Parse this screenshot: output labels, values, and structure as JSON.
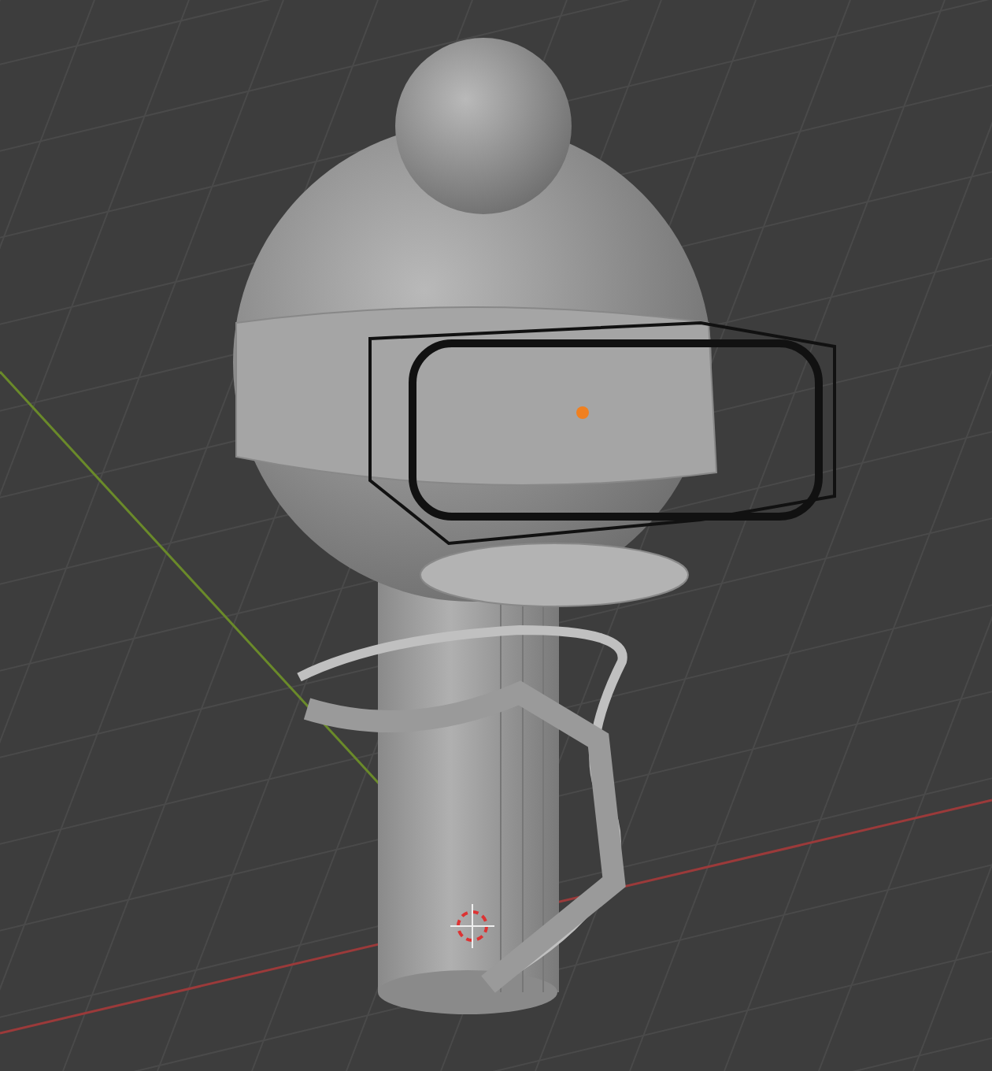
{
  "viewport": {
    "grid": true,
    "x_axis": true,
    "y_axis": true,
    "object": {
      "selected": true
    }
  }
}
